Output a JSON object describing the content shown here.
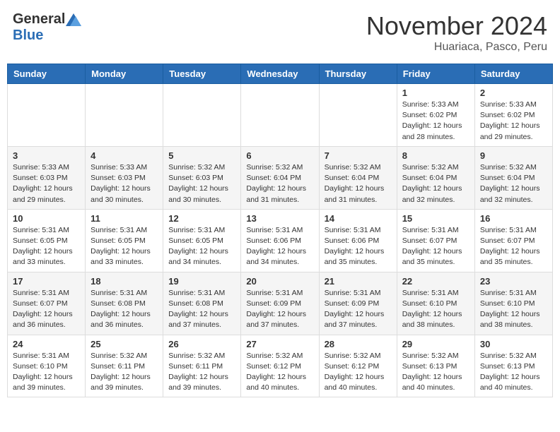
{
  "header": {
    "logo_general": "General",
    "logo_blue": "Blue",
    "month_title": "November 2024",
    "location": "Huariaca, Pasco, Peru"
  },
  "days_of_week": [
    "Sunday",
    "Monday",
    "Tuesday",
    "Wednesday",
    "Thursday",
    "Friday",
    "Saturday"
  ],
  "weeks": [
    [
      {
        "day": "",
        "info": ""
      },
      {
        "day": "",
        "info": ""
      },
      {
        "day": "",
        "info": ""
      },
      {
        "day": "",
        "info": ""
      },
      {
        "day": "",
        "info": ""
      },
      {
        "day": "1",
        "info": "Sunrise: 5:33 AM\nSunset: 6:02 PM\nDaylight: 12 hours\nand 28 minutes."
      },
      {
        "day": "2",
        "info": "Sunrise: 5:33 AM\nSunset: 6:02 PM\nDaylight: 12 hours\nand 29 minutes."
      }
    ],
    [
      {
        "day": "3",
        "info": "Sunrise: 5:33 AM\nSunset: 6:03 PM\nDaylight: 12 hours\nand 29 minutes."
      },
      {
        "day": "4",
        "info": "Sunrise: 5:33 AM\nSunset: 6:03 PM\nDaylight: 12 hours\nand 30 minutes."
      },
      {
        "day": "5",
        "info": "Sunrise: 5:32 AM\nSunset: 6:03 PM\nDaylight: 12 hours\nand 30 minutes."
      },
      {
        "day": "6",
        "info": "Sunrise: 5:32 AM\nSunset: 6:04 PM\nDaylight: 12 hours\nand 31 minutes."
      },
      {
        "day": "7",
        "info": "Sunrise: 5:32 AM\nSunset: 6:04 PM\nDaylight: 12 hours\nand 31 minutes."
      },
      {
        "day": "8",
        "info": "Sunrise: 5:32 AM\nSunset: 6:04 PM\nDaylight: 12 hours\nand 32 minutes."
      },
      {
        "day": "9",
        "info": "Sunrise: 5:32 AM\nSunset: 6:04 PM\nDaylight: 12 hours\nand 32 minutes."
      }
    ],
    [
      {
        "day": "10",
        "info": "Sunrise: 5:31 AM\nSunset: 6:05 PM\nDaylight: 12 hours\nand 33 minutes."
      },
      {
        "day": "11",
        "info": "Sunrise: 5:31 AM\nSunset: 6:05 PM\nDaylight: 12 hours\nand 33 minutes."
      },
      {
        "day": "12",
        "info": "Sunrise: 5:31 AM\nSunset: 6:05 PM\nDaylight: 12 hours\nand 34 minutes."
      },
      {
        "day": "13",
        "info": "Sunrise: 5:31 AM\nSunset: 6:06 PM\nDaylight: 12 hours\nand 34 minutes."
      },
      {
        "day": "14",
        "info": "Sunrise: 5:31 AM\nSunset: 6:06 PM\nDaylight: 12 hours\nand 35 minutes."
      },
      {
        "day": "15",
        "info": "Sunrise: 5:31 AM\nSunset: 6:07 PM\nDaylight: 12 hours\nand 35 minutes."
      },
      {
        "day": "16",
        "info": "Sunrise: 5:31 AM\nSunset: 6:07 PM\nDaylight: 12 hours\nand 35 minutes."
      }
    ],
    [
      {
        "day": "17",
        "info": "Sunrise: 5:31 AM\nSunset: 6:07 PM\nDaylight: 12 hours\nand 36 minutes."
      },
      {
        "day": "18",
        "info": "Sunrise: 5:31 AM\nSunset: 6:08 PM\nDaylight: 12 hours\nand 36 minutes."
      },
      {
        "day": "19",
        "info": "Sunrise: 5:31 AM\nSunset: 6:08 PM\nDaylight: 12 hours\nand 37 minutes."
      },
      {
        "day": "20",
        "info": "Sunrise: 5:31 AM\nSunset: 6:09 PM\nDaylight: 12 hours\nand 37 minutes."
      },
      {
        "day": "21",
        "info": "Sunrise: 5:31 AM\nSunset: 6:09 PM\nDaylight: 12 hours\nand 37 minutes."
      },
      {
        "day": "22",
        "info": "Sunrise: 5:31 AM\nSunset: 6:10 PM\nDaylight: 12 hours\nand 38 minutes."
      },
      {
        "day": "23",
        "info": "Sunrise: 5:31 AM\nSunset: 6:10 PM\nDaylight: 12 hours\nand 38 minutes."
      }
    ],
    [
      {
        "day": "24",
        "info": "Sunrise: 5:31 AM\nSunset: 6:10 PM\nDaylight: 12 hours\nand 39 minutes."
      },
      {
        "day": "25",
        "info": "Sunrise: 5:32 AM\nSunset: 6:11 PM\nDaylight: 12 hours\nand 39 minutes."
      },
      {
        "day": "26",
        "info": "Sunrise: 5:32 AM\nSunset: 6:11 PM\nDaylight: 12 hours\nand 39 minutes."
      },
      {
        "day": "27",
        "info": "Sunrise: 5:32 AM\nSunset: 6:12 PM\nDaylight: 12 hours\nand 40 minutes."
      },
      {
        "day": "28",
        "info": "Sunrise: 5:32 AM\nSunset: 6:12 PM\nDaylight: 12 hours\nand 40 minutes."
      },
      {
        "day": "29",
        "info": "Sunrise: 5:32 AM\nSunset: 6:13 PM\nDaylight: 12 hours\nand 40 minutes."
      },
      {
        "day": "30",
        "info": "Sunrise: 5:32 AM\nSunset: 6:13 PM\nDaylight: 12 hours\nand 40 minutes."
      }
    ]
  ]
}
